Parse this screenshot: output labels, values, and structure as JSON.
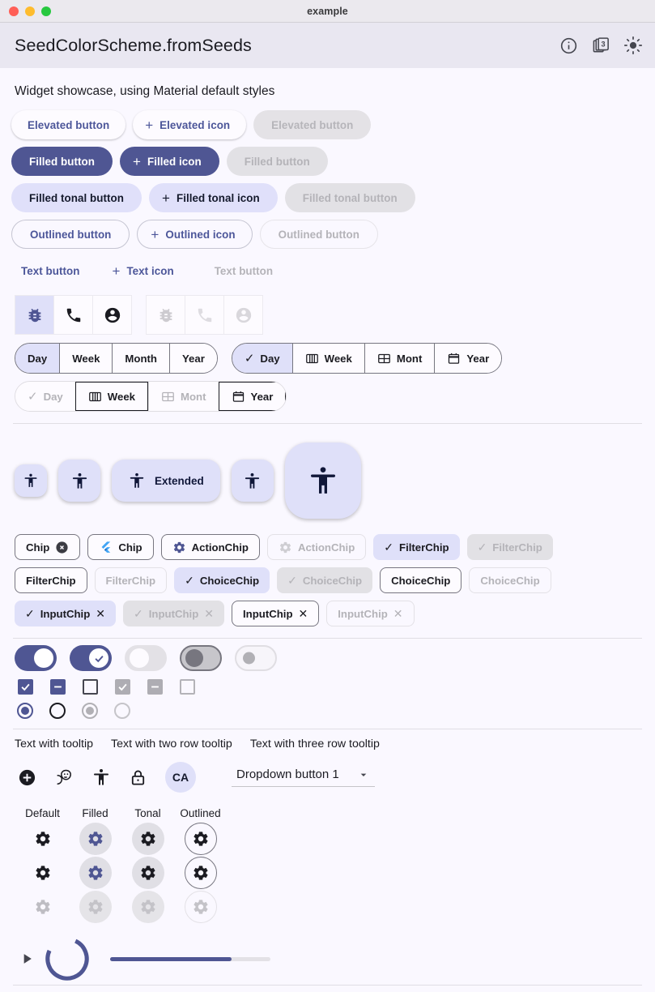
{
  "window": {
    "title": "example",
    "traffic_lights": [
      "close",
      "minimize",
      "zoom"
    ]
  },
  "appbar": {
    "title": "SeedColorScheme.fromSeeds",
    "actions": [
      {
        "name": "info-icon",
        "label": "info"
      },
      {
        "name": "copy-all-icon",
        "label": "3"
      },
      {
        "name": "brightness-icon",
        "label": "brightness"
      }
    ]
  },
  "showcase": {
    "heading": "Widget showcase, using Material default styles"
  },
  "buttons": {
    "elevated": {
      "label": "Elevated button",
      "icon_label": "Elevated icon",
      "disabled_label": "Elevated button"
    },
    "filled": {
      "label": "Filled button",
      "icon_label": "Filled icon",
      "disabled_label": "Filled button"
    },
    "tonal": {
      "label": "Filled tonal button",
      "icon_label": "Filled tonal icon",
      "disabled_label": "Filled tonal button"
    },
    "outlined": {
      "label": "Outlined button",
      "icon_label": "Outlined icon",
      "disabled_label": "Outlined button"
    },
    "text": {
      "label": "Text button",
      "icon_label": "Text icon",
      "disabled_label": "Text button"
    },
    "add_icon": "+"
  },
  "icon_toggle_groups": [
    {
      "enabled": true,
      "items": [
        {
          "icon": "bug-icon",
          "selected": true
        },
        {
          "icon": "phone-icon",
          "selected": false
        },
        {
          "icon": "account-circle-icon",
          "selected": false
        }
      ]
    },
    {
      "enabled": false,
      "items": [
        {
          "icon": "bug-icon",
          "selected": false
        },
        {
          "icon": "phone-icon",
          "selected": false
        },
        {
          "icon": "account-circle-icon",
          "selected": false
        }
      ]
    }
  ],
  "segmented": {
    "plain": {
      "enabled": true,
      "items": [
        {
          "label": "Day",
          "selected": true
        },
        {
          "label": "Week",
          "selected": false
        },
        {
          "label": "Month",
          "selected": false
        },
        {
          "label": "Year",
          "selected": false
        }
      ]
    },
    "with_icons": {
      "enabled": true,
      "items": [
        {
          "label": "Day",
          "icon": "check-icon",
          "selected": true
        },
        {
          "label": "Week",
          "icon": "calendar-view-week-icon",
          "selected": false
        },
        {
          "label": "Mont",
          "icon": "calendar-view-month-icon",
          "selected": false
        },
        {
          "label": "Year",
          "icon": "calendar-today-icon",
          "selected": false
        }
      ]
    },
    "disabled": {
      "enabled": false,
      "items": [
        {
          "label": "Day",
          "icon": "check-icon",
          "selected": false
        },
        {
          "label": "Week",
          "icon": "calendar-view-week-icon",
          "selected": true
        },
        {
          "label": "Mont",
          "icon": "calendar-view-month-icon",
          "selected": false
        },
        {
          "label": "Year",
          "icon": "calendar-today-icon",
          "selected": true
        }
      ]
    }
  },
  "fabs": [
    {
      "name": "fab-small",
      "size": "small",
      "icon": "accessibility-icon",
      "label": ""
    },
    {
      "name": "fab-standard",
      "size": "std",
      "icon": "accessibility-icon",
      "label": ""
    },
    {
      "name": "fab-extended",
      "size": "ext",
      "icon": "accessibility-icon",
      "label": "Extended"
    },
    {
      "name": "fab-standard-2",
      "size": "std",
      "icon": "accessibility-icon",
      "label": ""
    },
    {
      "name": "fab-large",
      "size": "large",
      "icon": "accessibility-icon",
      "label": ""
    }
  ],
  "chips": {
    "row1": [
      {
        "label": "Chip",
        "trailing_icon": "cancel-filled-icon",
        "state": "default"
      },
      {
        "label": "Chip",
        "leading_icon": "flutter-logo-icon",
        "state": "default"
      },
      {
        "label": "ActionChip",
        "leading_icon": "settings-icon",
        "state": "default"
      },
      {
        "label": "ActionChip",
        "leading_icon": "settings-icon",
        "state": "disabled"
      },
      {
        "label": "FilterChip",
        "leading_icon": "check-icon",
        "state": "selected"
      },
      {
        "label": "FilterChip",
        "leading_icon": "check-icon",
        "state": "disabled-filled"
      }
    ],
    "row2": [
      {
        "label": "FilterChip",
        "state": "default"
      },
      {
        "label": "FilterChip",
        "state": "disabled"
      },
      {
        "label": "ChoiceChip",
        "leading_icon": "check-icon",
        "state": "selected"
      },
      {
        "label": "ChoiceChip",
        "leading_icon": "check-icon",
        "state": "disabled-filled"
      },
      {
        "label": "ChoiceChip",
        "state": "default"
      },
      {
        "label": "ChoiceChip",
        "state": "disabled"
      }
    ],
    "row3": [
      {
        "label": "InputChip",
        "leading_icon": "check-icon",
        "trailing_icon": "close-icon",
        "state": "selected"
      },
      {
        "label": "InputChip",
        "leading_icon": "check-icon",
        "trailing_icon": "close-icon",
        "state": "disabled-filled"
      },
      {
        "label": "InputChip",
        "trailing_icon": "close-icon",
        "state": "default"
      },
      {
        "label": "InputChip",
        "trailing_icon": "close-icon",
        "state": "disabled"
      }
    ]
  },
  "switches": [
    {
      "name": "switch-on",
      "state": "on"
    },
    {
      "name": "switch-on-checked",
      "state": "on-check"
    },
    {
      "name": "switch-off",
      "state": "off"
    },
    {
      "name": "switch-disabled-on",
      "state": "dis-on"
    },
    {
      "name": "switch-disabled-off",
      "state": "dis-off"
    }
  ],
  "checkboxes": [
    {
      "name": "checkbox-checked",
      "state": "on"
    },
    {
      "name": "checkbox-indeterminate",
      "state": "indeterminate"
    },
    {
      "name": "checkbox-unchecked",
      "state": "off"
    },
    {
      "name": "checkbox-disabled-checked",
      "state": "dis-on"
    },
    {
      "name": "checkbox-disabled-indeterminate",
      "state": "dis-indeterminate"
    },
    {
      "name": "checkbox-disabled-unchecked",
      "state": "dis-off"
    }
  ],
  "radios": [
    {
      "name": "radio-selected",
      "state": "on"
    },
    {
      "name": "radio-unselected",
      "state": "off"
    },
    {
      "name": "radio-disabled-selected",
      "state": "dis-on"
    },
    {
      "name": "radio-disabled-unselected",
      "state": "dis-off"
    }
  ],
  "tooltips": [
    {
      "label": "Text with tooltip"
    },
    {
      "label": "Text with two row tooltip"
    },
    {
      "label": "Text with three row tooltip"
    }
  ],
  "misc_row": {
    "icons": [
      {
        "name": "add-circle-icon"
      },
      {
        "name": "theater-comedy-icon"
      },
      {
        "name": "accessibility-icon"
      },
      {
        "name": "lock-icon"
      }
    ],
    "avatar": "CA",
    "dropdown": {
      "value": "Dropdown button 1",
      "chevron": "chevron-down-icon"
    }
  },
  "icon_button_grid": {
    "headers": [
      "Default",
      "Filled",
      "Tonal",
      "Outlined"
    ],
    "rows": [
      {
        "name": "icon-button-row-enabled",
        "states": [
          "plain",
          "filled",
          "tonal",
          "outl"
        ],
        "disabled": false
      },
      {
        "name": "icon-button-row-toggled",
        "states": [
          "plain",
          "filled",
          "tonal",
          "outl"
        ],
        "disabled": false
      },
      {
        "name": "icon-button-row-disabled",
        "states": [
          "plain",
          "filled",
          "tonal",
          "outl"
        ],
        "disabled": true
      }
    ],
    "icon": "settings-icon"
  },
  "progress": {
    "play_icon": "play-arrow-icon",
    "circular": {
      "name": "circular-progress",
      "value": 75
    },
    "linear": {
      "name": "linear-progress",
      "value": 76
    }
  },
  "colors": {
    "primary": "#4f5693",
    "on_primary": "#ffffff",
    "primary_container": "#dfe0f9",
    "surface": "#faf8ff",
    "surface_variant": "#e9e7f1",
    "outline": "#777680",
    "disabled": "#b4b3b8",
    "titlebar": "#ebe9ee"
  }
}
